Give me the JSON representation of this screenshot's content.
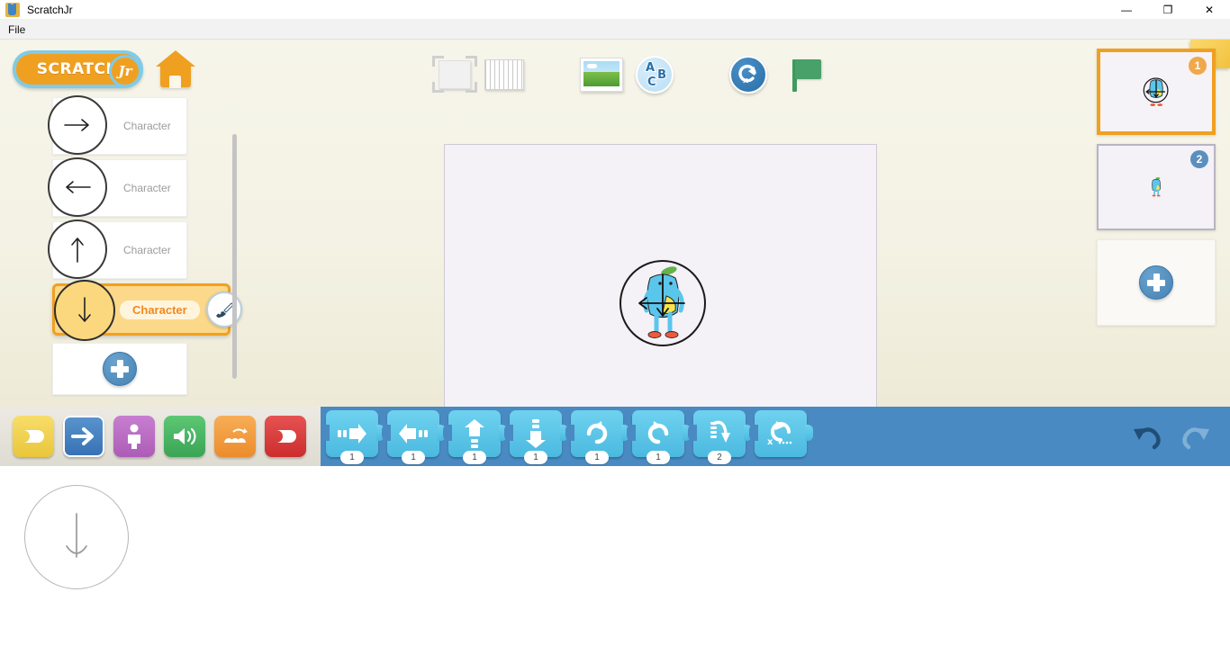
{
  "window": {
    "title": "ScratchJr",
    "app_icon": "scratchjr-cat-icon",
    "controls": {
      "minimize": "—",
      "maximize": "❐",
      "close": "✕"
    }
  },
  "menubar": {
    "items": [
      {
        "label": "File",
        "name": "menu-file"
      }
    ]
  },
  "brand": {
    "logo_text": "SCRATCH",
    "logo_badge": "Jr",
    "home_label": "Home"
  },
  "toolbar": {
    "items": [
      {
        "name": "fullscreen-icon",
        "label": "Full Screen"
      },
      {
        "name": "grid-icon",
        "label": "Grid"
      },
      {
        "name": "background-image-icon",
        "label": "Change Background"
      },
      {
        "name": "add-text-icon",
        "label": "Add Text",
        "letters": [
          "A",
          "B",
          "C"
        ]
      },
      {
        "name": "reset-all-icon",
        "label": "Reset Characters"
      },
      {
        "name": "green-flag-icon",
        "label": "Go"
      }
    ]
  },
  "character_list": {
    "items": [
      {
        "name": "character-item-1",
        "label": "Character",
        "direction": "right",
        "selected": false
      },
      {
        "name": "character-item-2",
        "label": "Character",
        "direction": "left",
        "selected": false
      },
      {
        "name": "character-item-3",
        "label": "Character",
        "direction": "up",
        "selected": false
      },
      {
        "name": "character-item-4",
        "label": "Character",
        "direction": "down",
        "selected": true
      }
    ],
    "add_button": {
      "name": "add-character-button",
      "label": "+"
    },
    "edit_button": {
      "name": "paint-editor-icon",
      "label": "Edit"
    }
  },
  "stage": {
    "name": "stage-canvas",
    "selected_sprite": "blue-bird-character"
  },
  "pages": {
    "items": [
      {
        "number": "1",
        "selected": true,
        "name": "page-thumbnail-1"
      },
      {
        "number": "2",
        "selected": false,
        "name": "page-thumbnail-2"
      }
    ],
    "add_button": {
      "name": "add-page-button",
      "label": "+"
    }
  },
  "palette": {
    "categories": [
      {
        "name": "category-triggers",
        "label": "Triggering Blocks",
        "color": "#f2d04b",
        "selected": false
      },
      {
        "name": "category-motion",
        "label": "Motion Blocks",
        "color": "#3e7dc2",
        "selected": true
      },
      {
        "name": "category-looks",
        "label": "Looks Blocks",
        "color": "#b96dc0",
        "selected": false
      },
      {
        "name": "category-sound",
        "label": "Sound Blocks",
        "color": "#4cb964",
        "selected": false
      },
      {
        "name": "category-control",
        "label": "Control Blocks",
        "color": "#f29b3c",
        "selected": false
      },
      {
        "name": "category-end",
        "label": "End Blocks",
        "color": "#db3b3b",
        "selected": false
      }
    ],
    "blocks": [
      {
        "name": "block-move-right",
        "label": "Move Right",
        "param": "1",
        "glyph": "right"
      },
      {
        "name": "block-move-left",
        "label": "Move Left",
        "param": "1",
        "glyph": "left"
      },
      {
        "name": "block-move-up",
        "label": "Move Up",
        "param": "1",
        "glyph": "up"
      },
      {
        "name": "block-move-down",
        "label": "Move Down",
        "param": "1",
        "glyph": "down"
      },
      {
        "name": "block-turn-right",
        "label": "Turn Right",
        "param": "1",
        "glyph": "turn-right"
      },
      {
        "name": "block-turn-left",
        "label": "Turn Left",
        "param": "1",
        "glyph": "turn-left"
      },
      {
        "name": "block-hop",
        "label": "Hop",
        "param": "2",
        "glyph": "hop"
      },
      {
        "name": "block-go-home",
        "label": "Go Home",
        "param": "",
        "glyph": "go-home"
      }
    ],
    "undo": {
      "name": "undo-button",
      "label": "Undo",
      "enabled": true
    },
    "redo": {
      "name": "redo-button",
      "label": "Redo",
      "enabled": false
    }
  },
  "drag_ghost": {
    "name": "dragged-character-thumbnail",
    "direction": "down"
  },
  "colors": {
    "accent_orange": "#f0a021",
    "palette_blue": "#4a8ac2",
    "block_blue": "#4bb9e0",
    "canvas_cream": "#f4f2e4",
    "stage_bg": "#f4f1f7"
  }
}
